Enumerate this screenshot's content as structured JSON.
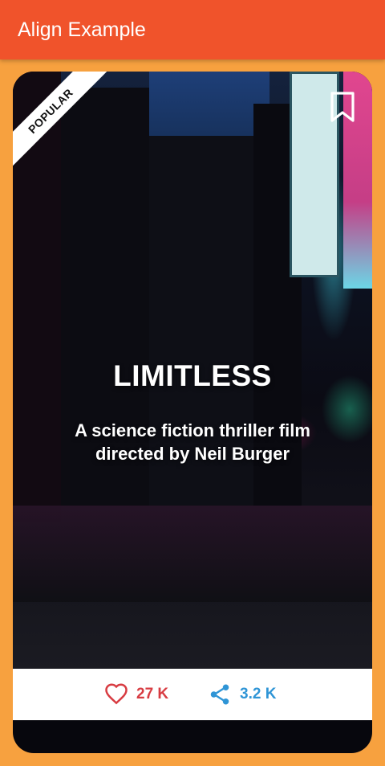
{
  "appbar": {
    "title": "Align Example",
    "background_color": "#F0532B"
  },
  "page": {
    "background_color": "#F7A13F"
  },
  "card": {
    "badge": "POPULAR",
    "bookmark_icon": "bookmark-outline-icon",
    "title": "LIMITLESS",
    "description": "A science fiction thriller film directed by Neil Burger",
    "actions": {
      "likes": {
        "icon": "heart-outline-icon",
        "count": "27 K",
        "color": "#D83C42"
      },
      "shares": {
        "icon": "share-icon",
        "count": "3.2 K",
        "color": "#2F95D6"
      }
    }
  }
}
